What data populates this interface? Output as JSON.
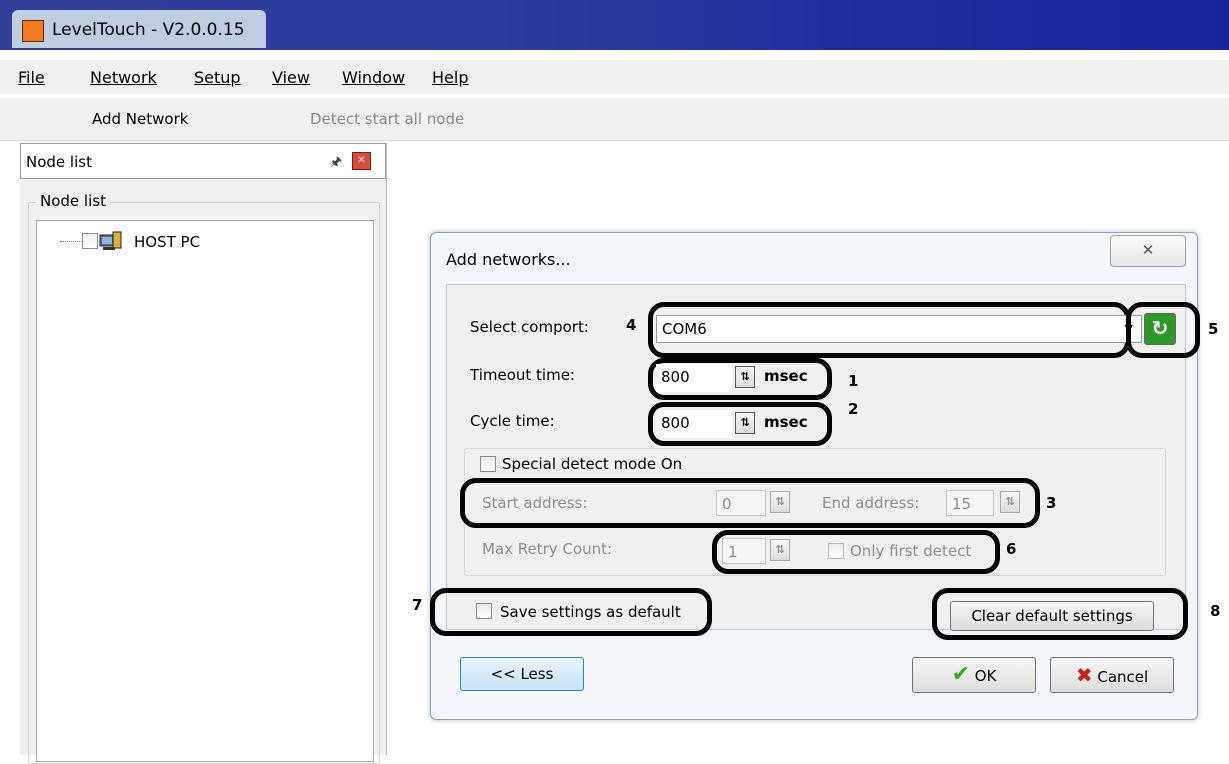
{
  "window": {
    "title": "LevelTouch - V2.0.0.15"
  },
  "menu": [
    {
      "label": "File"
    },
    {
      "label": "Network"
    },
    {
      "label": "Setup"
    },
    {
      "label": "View"
    },
    {
      "label": "Window"
    },
    {
      "label": "Help"
    }
  ],
  "toolbar": {
    "add_network": "Add Network",
    "detect_all": "Detect start all node"
  },
  "node_list": {
    "header": "Node list",
    "group_label": "Node list",
    "items": [
      {
        "label": "HOST PC"
      }
    ]
  },
  "dialog": {
    "title": "Add networks...",
    "select_comport_label": "Select comport:",
    "comport_value": "COM6",
    "timeout_label": "Timeout time:",
    "timeout_value": "800",
    "timeout_unit": "msec",
    "cycle_label": "Cycle time:",
    "cycle_value": "800",
    "cycle_unit": "msec",
    "special_detect_label": "Special detect mode On",
    "start_address_label": "Start address:",
    "start_address_value": "0",
    "end_address_label": "End address:",
    "end_address_value": "15",
    "max_retry_label": "Max Retry Count:",
    "max_retry_value": "1",
    "only_first_detect_label": "Only first detect",
    "save_default_label": "Save settings as default",
    "clear_default_label": "Clear default settings",
    "less_label": "<< Less",
    "ok_label": "OK",
    "cancel_label": "Cancel"
  },
  "callouts": [
    "1",
    "2",
    "3",
    "4",
    "5",
    "6",
    "7",
    "8"
  ],
  "colors": {
    "titlebar": "#2a3e9c",
    "app_icon": "#f17a1c",
    "ok_check": "#3aa827",
    "cancel_x": "#c8201a",
    "refresh": "#2e9a2a"
  },
  "icons": {
    "app": "app-icon",
    "pin": "pin-icon",
    "close": "close-icon",
    "host": "host-pc-icon",
    "refresh": "refresh-icon",
    "ok": "checkmark-icon",
    "cancel": "x-icon"
  }
}
